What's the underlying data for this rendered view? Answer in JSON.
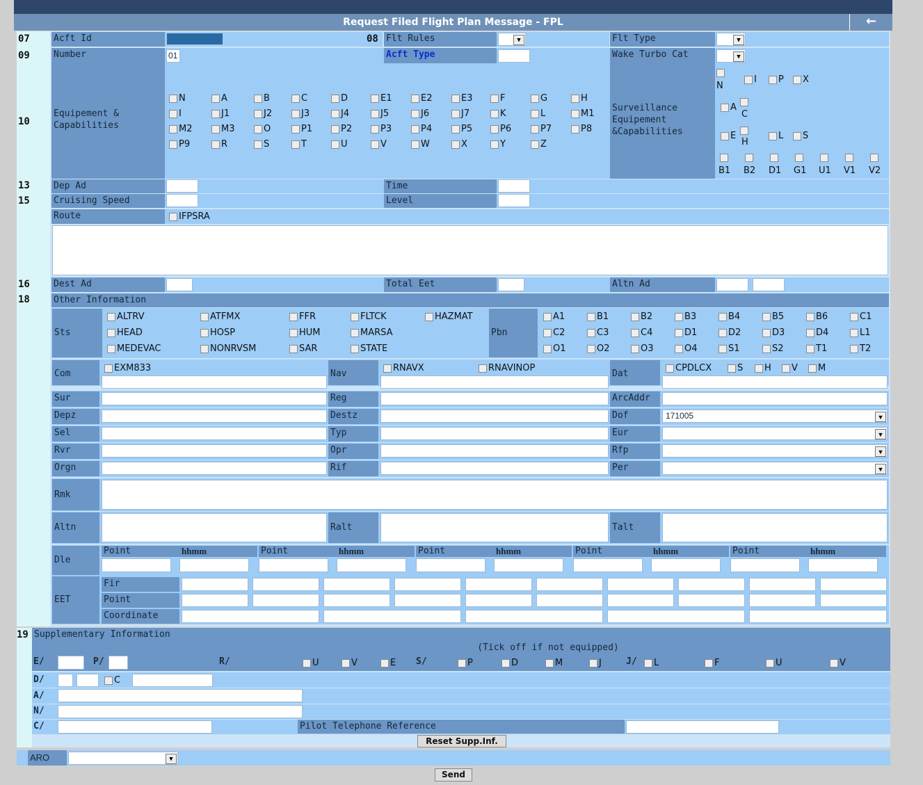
{
  "title": "Request Filed Flight Plan Message - FPL",
  "back_icon": "arrow-left-icon",
  "rows": {
    "n07": "07",
    "n08": "08",
    "n09": "09",
    "n10": "10",
    "n13": "13",
    "n15": "15",
    "n16": "16",
    "n18": "18",
    "n19": "19"
  },
  "labels": {
    "acft_id": "Acft Id",
    "flt_rules": "Flt Rules",
    "flt_type": "Flt Type",
    "number": "Number",
    "acft_type": "Acft Type",
    "wake": "Wake Turbo Cat",
    "equip": "Equipement & Capabilities",
    "surv": "Surveillance Equipement &Capabilities",
    "dep_ad": "Dep Ad",
    "time": "Time",
    "cruise": "Cruising Speed",
    "level": "Level",
    "route": "Route",
    "ifpsra": "IFPSRA",
    "dest_ad": "Dest Ad",
    "total_eet": "Total Eet",
    "altn_ad": "Altn Ad",
    "other": "Other Information",
    "sts": "Sts",
    "pbn": "Pbn",
    "com": "Com",
    "nav": "Nav",
    "dat": "Dat",
    "sur": "Sur",
    "reg": "Reg",
    "arcaddr": "ArcAddr",
    "depz": "Depz",
    "destz": "Destz",
    "dof": "Dof",
    "sel": "Sel",
    "typ": "Typ",
    "eur": "Eur",
    "rvr": "Rvr",
    "opr": "Opr",
    "rfp": "Rfp",
    "orgn": "Orgn",
    "rif": "Rif",
    "per": "Per",
    "rmk": "Rmk",
    "altn": "Altn",
    "ralt": "Ralt",
    "talt": "Talt",
    "dle": "Dle",
    "eet": "EET",
    "fir": "Fir",
    "point": "Point",
    "coordinate": "Coordinate",
    "hhmm": "hhmm",
    "supp": "Supplementary Information",
    "tick": "(Tick off if not equipped)",
    "e": "E/",
    "p": "P/",
    "r": "R/",
    "s": "S/",
    "j": "J/",
    "d": "D/",
    "a": "A/",
    "nn": "N/",
    "c": "C/",
    "pilot_tel": "Pilot Telephone Reference",
    "aro": "ARO"
  },
  "values": {
    "number": "01",
    "dof": "171005"
  },
  "equip_rows": [
    [
      "N",
      "A",
      "B",
      "C",
      "D",
      "E1",
      "E2",
      "E3",
      "F",
      "G",
      "H"
    ],
    [
      "I",
      "J1",
      "J2",
      "J3",
      "J4",
      "J5",
      "J6",
      "J7",
      "K",
      "L",
      "M1"
    ],
    [
      "M2",
      "M3",
      "O",
      "P1",
      "P2",
      "P3",
      "P4",
      "P5",
      "P6",
      "P7",
      "P8"
    ],
    [
      "P9",
      "R",
      "S",
      "T",
      "U",
      "V",
      "W",
      "X",
      "Y",
      "Z"
    ]
  ],
  "surv": {
    "r1": [
      "N",
      "I",
      "P",
      "X"
    ],
    "r2": [
      "A",
      "C"
    ],
    "r3": [
      "E",
      "H",
      "L",
      "S"
    ],
    "r4": [
      "B1",
      "B2",
      "D1",
      "G1",
      "U1",
      "V1",
      "V2"
    ]
  },
  "sts": [
    [
      "ALTRV",
      "ATFMX",
      "FFR",
      "FLTCK",
      "HAZMAT"
    ],
    [
      "HEAD",
      "HOSP",
      "HUM",
      "MARSA"
    ],
    [
      "MEDEVAC",
      "NONRVSM",
      "SAR",
      "STATE"
    ]
  ],
  "pbn": [
    [
      "A1",
      "B1",
      "B2",
      "B3",
      "B4",
      "B5",
      "B6",
      "C1"
    ],
    [
      "C2",
      "C3",
      "C4",
      "D1",
      "D2",
      "D3",
      "D4",
      "L1"
    ],
    [
      "O1",
      "O2",
      "O3",
      "O4",
      "S1",
      "S2",
      "T1",
      "T2"
    ]
  ],
  "com_opts": [
    "EXM833"
  ],
  "nav_opts": [
    "RNAVX",
    "RNAVINOP"
  ],
  "dat_opts": [
    "CPDLCX",
    "S",
    "H",
    "V",
    "M"
  ],
  "r_opts": [
    "U",
    "V",
    "E"
  ],
  "s_opts": [
    "P",
    "D",
    "M",
    "J"
  ],
  "j_opts": [
    "L",
    "F",
    "U",
    "V"
  ],
  "d_opt": "C",
  "buttons": {
    "reset": "Reset Supp.Inf.",
    "send": "Send"
  }
}
